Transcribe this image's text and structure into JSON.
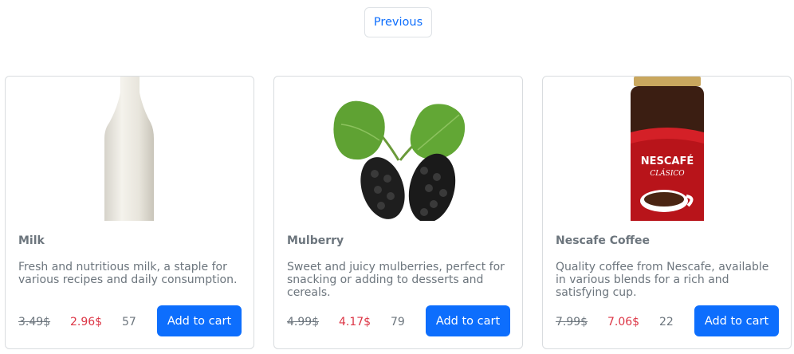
{
  "pagination": {
    "previous_label": "Previous"
  },
  "products": [
    {
      "name": "Milk",
      "description": "Fresh and nutritious milk, a staple for various recipes and daily consumption.",
      "old_price": "3.49$",
      "new_price": "2.96$",
      "stock": "57",
      "button_label": "Add to cart",
      "image_icon": "milk-bottle-icon"
    },
    {
      "name": "Mulberry",
      "description": "Sweet and juicy mulberries, perfect for snacking or adding to desserts and cereals.",
      "old_price": "4.99$",
      "new_price": "4.17$",
      "stock": "79",
      "button_label": "Add to cart",
      "image_icon": "mulberry-icon"
    },
    {
      "name": "Nescafe Coffee",
      "description": "Quality coffee from Nescafe, available in various blends for a rich and satisfying cup.",
      "old_price": "7.99$",
      "new_price": "7.06$",
      "stock": "22",
      "button_label": "Add to cart",
      "image_icon": "coffee-jar-icon",
      "jar_label": "NESCAFÉ",
      "jar_sublabel": "CLÁSICO"
    }
  ],
  "colors": {
    "primary": "#0d6efd",
    "sale": "#dc3545",
    "muted": "#6c757d"
  }
}
